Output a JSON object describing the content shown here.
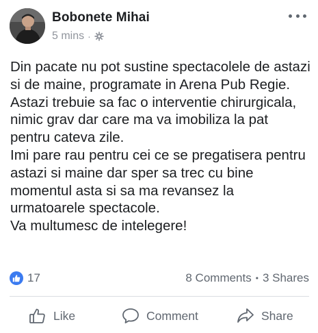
{
  "post": {
    "author": "Bobonete Mihai",
    "time": "5 mins",
    "meta_separator": "·",
    "audience_icon": "gear-icon",
    "more_icon": "more-horizontal-icon",
    "paragraphs": [
      "Din pacate nu pot sustine spectacolele de astazi si de maine, programate in Arena Pub Regie.",
      "Astazi trebuie sa fac o interventie chirurgicala, nimic grav dar care ma va imobiliza la pat pentru cateva zile.",
      "Imi pare rau pentru cei ce se pregatisera pentru astazi si maine dar sper sa trec cu bine momentul asta si sa ma revansez la urmatoarele spectacole.",
      "Va multumesc de intelegere!"
    ]
  },
  "stats": {
    "reaction_icon": "like-reaction-icon",
    "reaction_count": "17",
    "comments": "8 Comments",
    "separator": "•",
    "shares": "3 Shares"
  },
  "actions": {
    "like_label": "Like",
    "comment_label": "Comment",
    "share_label": "Share"
  },
  "colors": {
    "accent": "#3b7bf0",
    "text": "#1c1e21",
    "secondary_text": "#606770",
    "meta_text": "#90949c",
    "divider": "#dadde1"
  }
}
